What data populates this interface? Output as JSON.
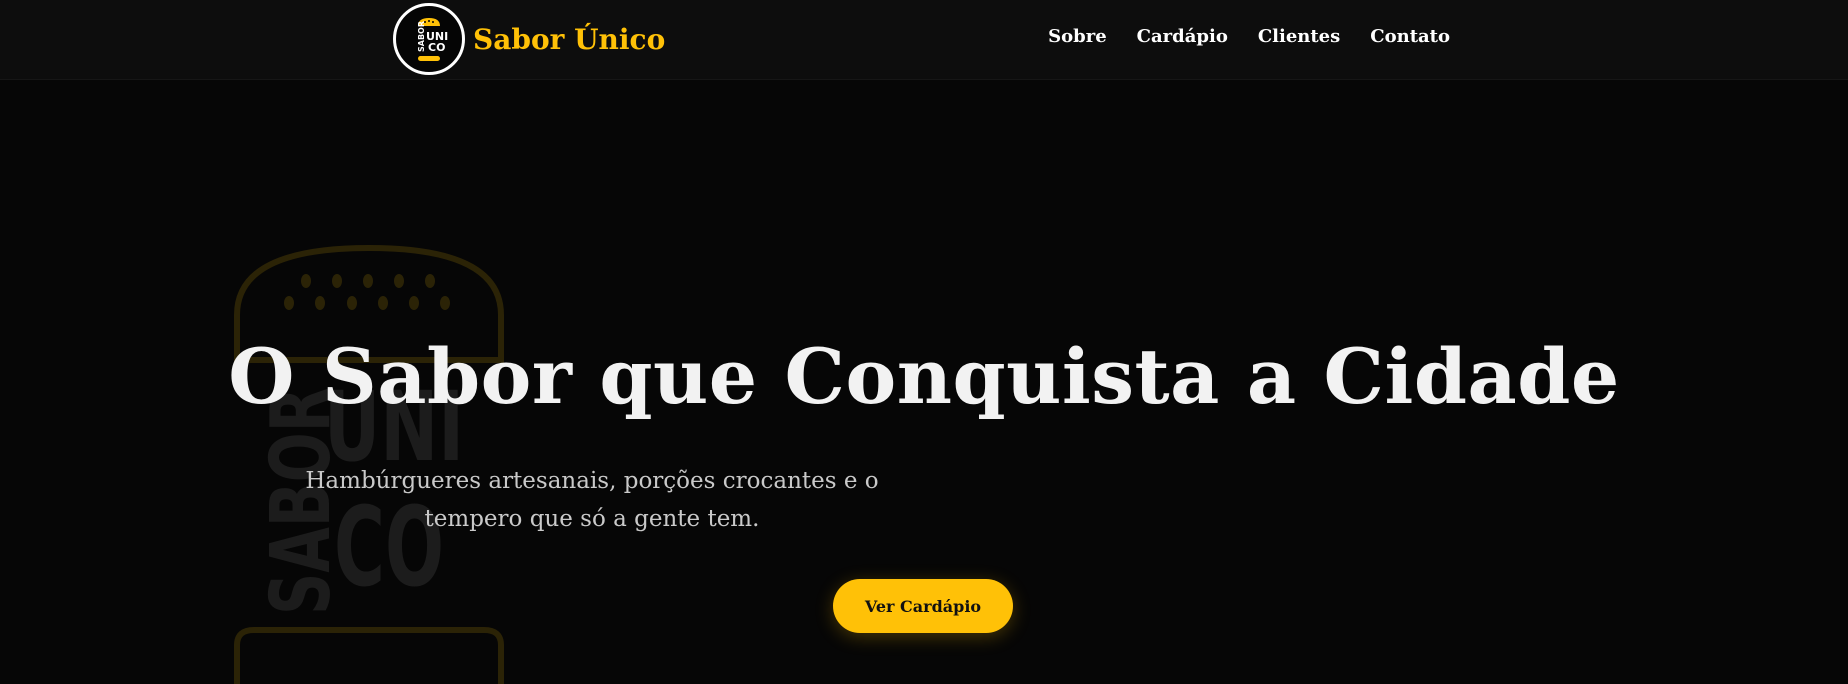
{
  "brand": {
    "name": "Sabor Único",
    "logo_text": [
      "SABOR",
      "UNI",
      "CO"
    ],
    "accent_color": "#ffc107"
  },
  "nav": {
    "links": [
      "Sobre",
      "Cardápio",
      "Clientes",
      "Contato"
    ]
  },
  "hero": {
    "title": "O Sabor que Conquista a Cidade",
    "subtitle": "Hambúrgueres artesanais, porções crocantes e o tempero que só a gente tem.",
    "cta_label": "Ver Cardápio",
    "watermark_text": [
      "SABOR",
      "UNI",
      "CO"
    ]
  }
}
